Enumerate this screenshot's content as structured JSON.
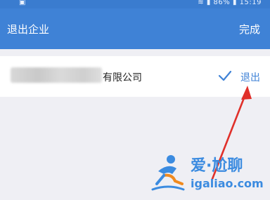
{
  "status": {
    "battery": "86%",
    "time": "15:19"
  },
  "header": {
    "title": "退出企业",
    "done_label": "完成"
  },
  "company": {
    "name_suffix": "有限公司",
    "exit_label": "退出"
  },
  "watermark": {
    "brand": "爱·尬聊",
    "url": "igaliao.com"
  },
  "colors": {
    "header": "#3f82d6",
    "accent": "#3f82d6",
    "arrow": "#e0302a"
  }
}
